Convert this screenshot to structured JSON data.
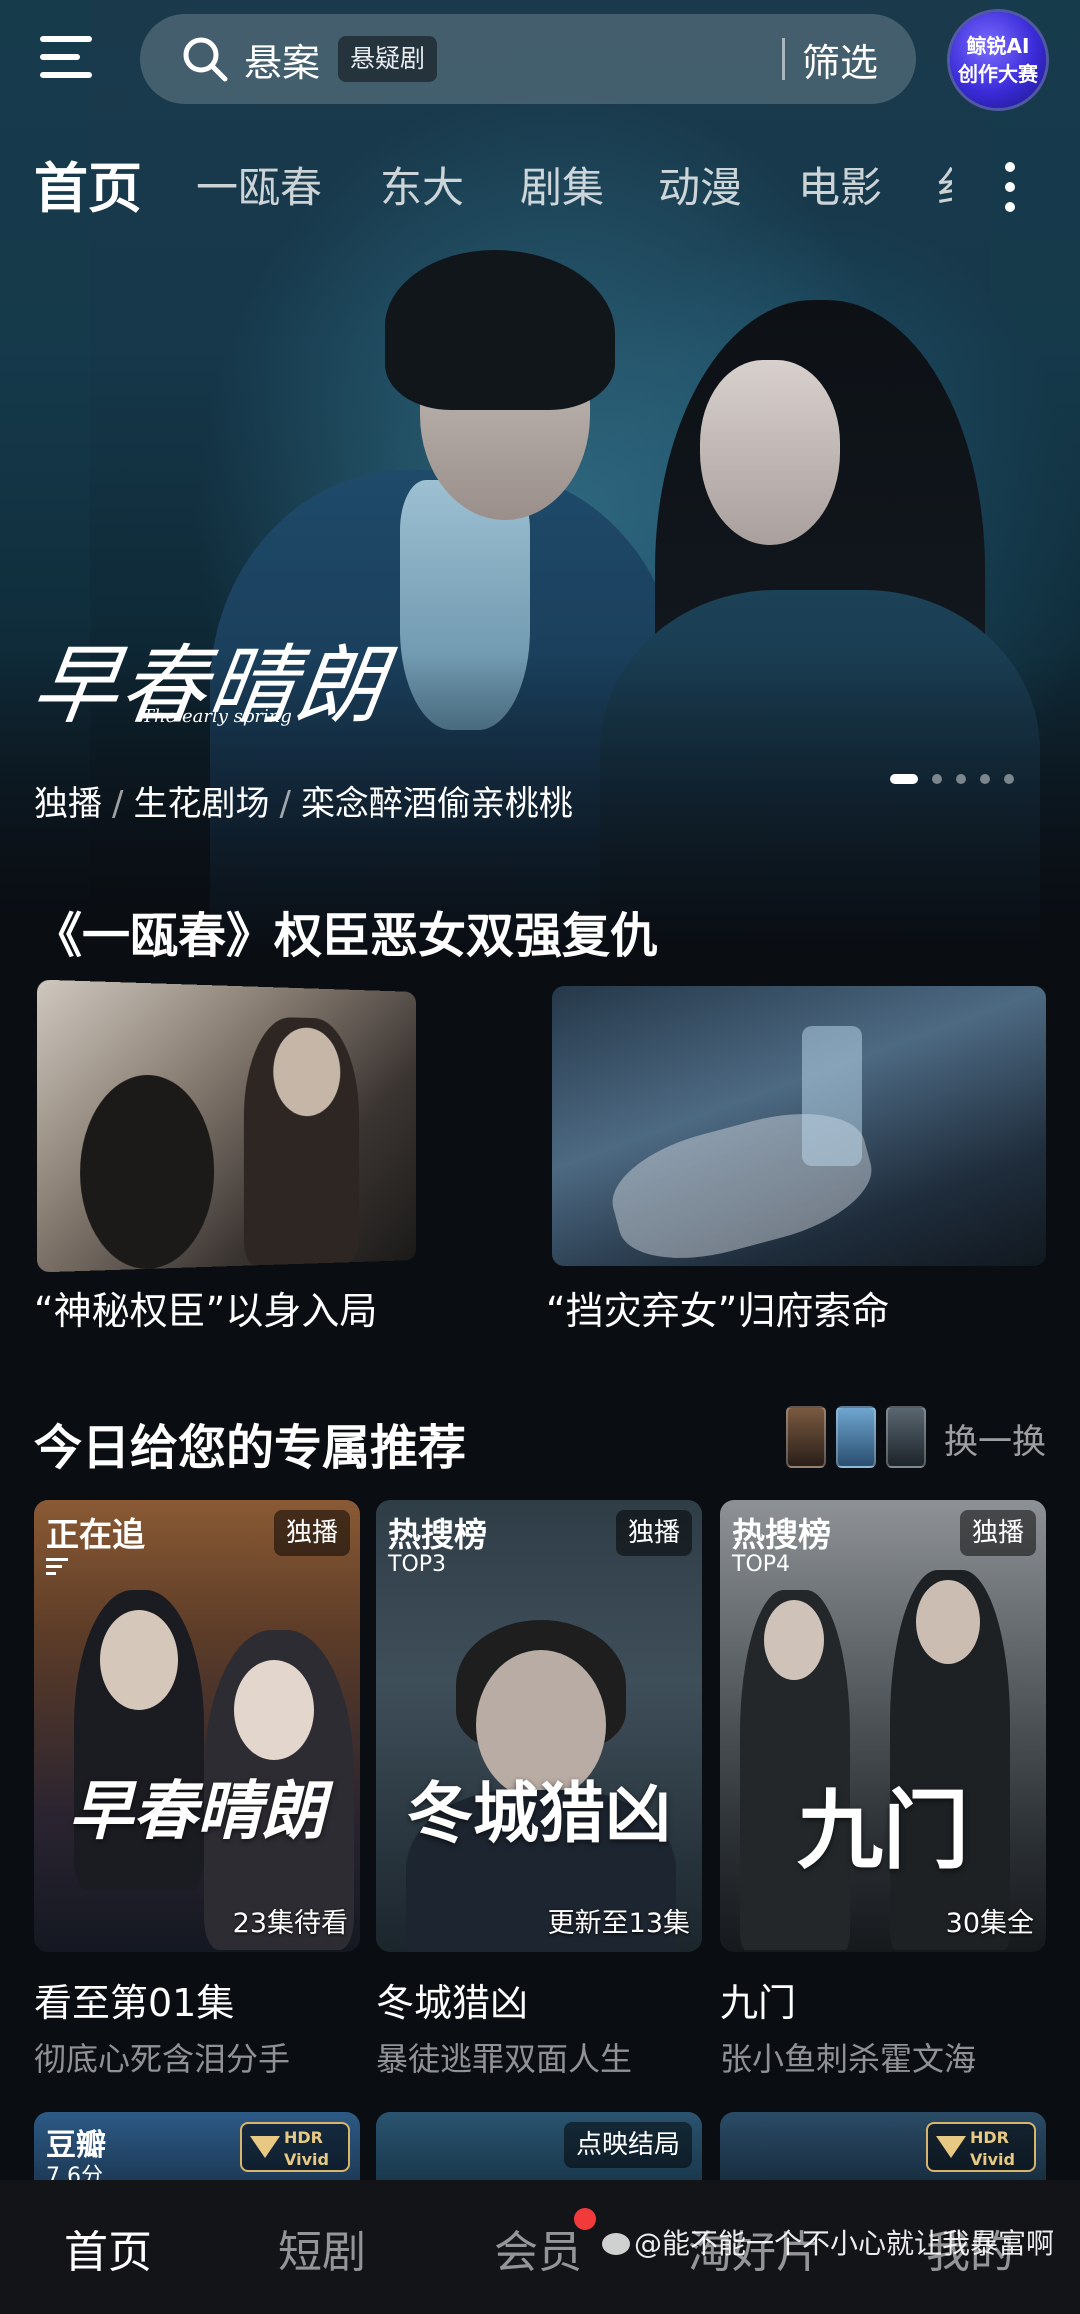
{
  "search": {
    "query": "悬案",
    "tag": "悬疑剧",
    "filter_label": "筛选"
  },
  "promo": {
    "line1": "鲸锐AI",
    "line2": "创作大赛"
  },
  "tabs": [
    "首页",
    "一瓯春",
    "东大",
    "剧集",
    "动漫",
    "电影",
    "纟"
  ],
  "hero": {
    "logo": "早春晴朗",
    "logo_sub": "The early spring",
    "tags": [
      "独播",
      "生花剧场",
      "栾念醉酒偷亲桃桃"
    ],
    "carousel_count": 5,
    "carousel_active": 0
  },
  "feature": {
    "title": "《一瓯春》权臣恶女双强复仇",
    "items": [
      {
        "caption": "“神秘权臣”以身入局"
      },
      {
        "caption": "“挡灾弃女”归府索命"
      }
    ]
  },
  "recommend": {
    "title": "今日给您的专属推荐",
    "refresh_label": "换一换",
    "cards": [
      {
        "badge": "正在追",
        "badge_sub": "",
        "right_badge": "独播",
        "status": "23集待看",
        "logo": "早春晴朗",
        "title": "看至第01集",
        "subtitle": "彻底心死含泪分手",
        "color_top": "#6a4a2e",
        "color_bottom": "#1a1f2c"
      },
      {
        "badge": "热搜榜",
        "badge_sub": "TOP3",
        "right_badge": "独播",
        "status": "更新至13集",
        "logo": "冬城猎凶",
        "title": "冬城猎凶",
        "subtitle": "暴徒逃罪双面人生",
        "color_top": "#3a4a56",
        "color_bottom": "#13181d"
      },
      {
        "badge": "热搜榜",
        "badge_sub": "TOP4",
        "right_badge": "独播",
        "status": "30集全",
        "logo": "九门",
        "title": "九门",
        "subtitle": "张小鱼刺杀霍文海",
        "color_top": "#6b6f73",
        "color_bottom": "#1c1f22"
      }
    ],
    "next_row": [
      {
        "badge": "豆瓣",
        "badge_sub": "7.6分",
        "right_badge": "HDR Vivid"
      },
      {
        "badge": "",
        "badge_sub": "",
        "right_badge": "点映结局"
      },
      {
        "badge": "",
        "badge_sub": "",
        "right_badge": "HDR Vivid"
      }
    ]
  },
  "bottom_nav": [
    {
      "label": "首页",
      "active": true
    },
    {
      "label": "短剧",
      "active": false
    },
    {
      "label": "会员",
      "active": false,
      "notification": true
    },
    {
      "label": "淘好片",
      "active": false
    },
    {
      "label": "我的",
      "active": false
    }
  ],
  "watermark": "@能不能一个不小心就让我暴富啊",
  "colors": {
    "background": "#0a0d12",
    "notification": "#f23a3a",
    "hdr_gold": "#e7c983"
  }
}
